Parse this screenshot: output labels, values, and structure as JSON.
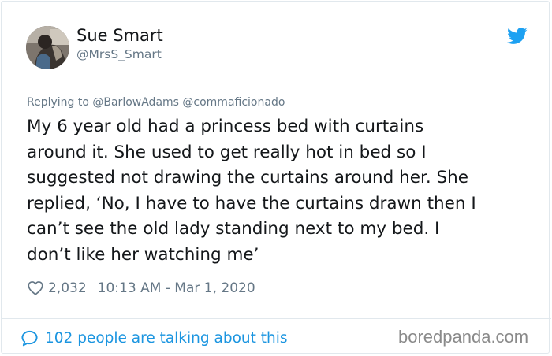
{
  "tweet": {
    "display_name": "Sue Smart",
    "handle": "@MrsS_Smart",
    "replying_to": "Replying to @BarlowAdams @commaficionado",
    "text_lines": [
      "My 6 year old had a princess bed with curtains",
      "around it. She used to get really hot in bed so I",
      "suggested not drawing the curtains around her. She",
      "replied, ‘No, I have to have the curtains drawn then I",
      "can’t see the old lady standing next to my bed. I",
      "don’t like her watching me’"
    ],
    "like_count": "2,032",
    "timestamp": "10:13 AM - Mar 1, 2020",
    "talking_about": "102 people are talking about this"
  },
  "watermark": "boredpanda.com",
  "icons": {
    "brand": "twitter-bird-icon",
    "like": "heart-icon",
    "conversation": "speech-bubble-icon"
  },
  "colors": {
    "twitter_blue": "#1da1f2",
    "link_blue": "#1b95e0",
    "secondary_text": "#657786",
    "primary_text": "#14171a"
  }
}
